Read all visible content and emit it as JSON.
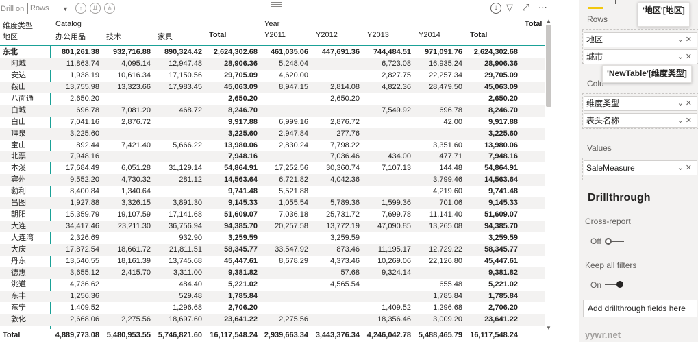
{
  "toolbar": {
    "drill_label": "Drill on",
    "drill_value": "Rows",
    "icons": [
      "arrow-up-icon",
      "double-arrow-down-icon",
      "expand-icon",
      "drill-down-icon",
      "filter-icon",
      "focus-mode-icon",
      "more-options-icon"
    ]
  },
  "matrix": {
    "row_headers": [
      "维度类型",
      "地区"
    ],
    "group_headers": {
      "catalog": "Catalog",
      "year": "Year",
      "grand_total": "Total"
    },
    "columns": [
      "办公用品",
      "技术",
      "家具",
      "Total",
      "Y2011",
      "Y2012",
      "Y2013",
      "Y2014",
      "Total"
    ],
    "rows": [
      {
        "name": "东北",
        "level": 0,
        "values": [
          "801,261.38",
          "932,716.88",
          "890,324.42",
          "2,624,302.68",
          "461,035.06",
          "447,691.36",
          "744,484.51",
          "971,091.76",
          "2,624,302.68"
        ]
      },
      {
        "name": "阿城",
        "level": 1,
        "values": [
          "11,863.74",
          "4,095.14",
          "12,947.48",
          "28,906.36",
          "5,248.04",
          "",
          "6,723.08",
          "16,935.24",
          "28,906.36"
        ]
      },
      {
        "name": "安达",
        "level": 1,
        "values": [
          "1,938.19",
          "10,616.34",
          "17,150.56",
          "29,705.09",
          "4,620.00",
          "",
          "2,827.75",
          "22,257.34",
          "29,705.09"
        ]
      },
      {
        "name": "鞍山",
        "level": 1,
        "values": [
          "13,755.98",
          "13,323.66",
          "17,983.45",
          "45,063.09",
          "8,947.15",
          "2,814.08",
          "4,822.36",
          "28,479.50",
          "45,063.09"
        ]
      },
      {
        "name": "八面通",
        "level": 1,
        "values": [
          "2,650.20",
          "",
          "",
          "2,650.20",
          "",
          "2,650.20",
          "",
          "",
          "2,650.20"
        ]
      },
      {
        "name": "白城",
        "level": 1,
        "values": [
          "696.78",
          "7,081.20",
          "468.72",
          "8,246.70",
          "",
          "",
          "7,549.92",
          "696.78",
          "8,246.70"
        ]
      },
      {
        "name": "白山",
        "level": 1,
        "values": [
          "7,041.16",
          "2,876.72",
          "",
          "9,917.88",
          "6,999.16",
          "2,876.72",
          "",
          "42.00",
          "9,917.88"
        ]
      },
      {
        "name": "拜泉",
        "level": 1,
        "values": [
          "3,225.60",
          "",
          "",
          "3,225.60",
          "2,947.84",
          "277.76",
          "",
          "",
          "3,225.60"
        ]
      },
      {
        "name": "宝山",
        "level": 1,
        "values": [
          "892.44",
          "7,421.40",
          "5,666.22",
          "13,980.06",
          "2,830.24",
          "7,798.22",
          "",
          "3,351.60",
          "13,980.06"
        ]
      },
      {
        "name": "北票",
        "level": 1,
        "values": [
          "7,948.16",
          "",
          "",
          "7,948.16",
          "",
          "7,036.46",
          "434.00",
          "477.71",
          "7,948.16"
        ]
      },
      {
        "name": "本溪",
        "level": 1,
        "values": [
          "17,684.49",
          "6,051.28",
          "31,129.14",
          "54,864.91",
          "17,252.56",
          "30,360.74",
          "7,107.13",
          "144.48",
          "54,864.91"
        ]
      },
      {
        "name": "宾州",
        "level": 1,
        "values": [
          "9,552.20",
          "4,730.32",
          "281.12",
          "14,563.64",
          "6,721.82",
          "4,042.36",
          "",
          "3,799.46",
          "14,563.64"
        ]
      },
      {
        "name": "勃利",
        "level": 1,
        "values": [
          "8,400.84",
          "1,340.64",
          "",
          "9,741.48",
          "5,521.88",
          "",
          "",
          "4,219.60",
          "9,741.48"
        ]
      },
      {
        "name": "昌图",
        "level": 1,
        "values": [
          "1,927.88",
          "3,326.15",
          "3,891.30",
          "9,145.33",
          "1,055.54",
          "5,789.36",
          "1,599.36",
          "701.06",
          "9,145.33"
        ]
      },
      {
        "name": "朝阳",
        "level": 1,
        "values": [
          "15,359.79",
          "19,107.59",
          "17,141.68",
          "51,609.07",
          "7,036.18",
          "25,731.72",
          "7,699.78",
          "11,141.40",
          "51,609.07"
        ]
      },
      {
        "name": "大连",
        "level": 1,
        "values": [
          "34,417.46",
          "23,211.30",
          "36,756.94",
          "94,385.70",
          "20,257.58",
          "13,772.19",
          "47,090.85",
          "13,265.08",
          "94,385.70"
        ]
      },
      {
        "name": "大连湾",
        "level": 1,
        "values": [
          "2,326.69",
          "",
          "932.90",
          "3,259.59",
          "",
          "3,259.59",
          "",
          "",
          "3,259.59"
        ]
      },
      {
        "name": "大庆",
        "level": 1,
        "values": [
          "17,872.54",
          "18,661.72",
          "21,811.51",
          "58,345.77",
          "33,547.92",
          "873.46",
          "11,195.17",
          "12,729.22",
          "58,345.77"
        ]
      },
      {
        "name": "丹东",
        "level": 1,
        "values": [
          "13,540.55",
          "18,161.39",
          "13,745.68",
          "45,447.61",
          "8,678.29",
          "4,373.46",
          "10,269.06",
          "22,126.80",
          "45,447.61"
        ]
      },
      {
        "name": "德惠",
        "level": 1,
        "values": [
          "3,655.12",
          "2,415.70",
          "3,311.00",
          "9,381.82",
          "",
          "57.68",
          "9,324.14",
          "",
          "9,381.82"
        ]
      },
      {
        "name": "洮道",
        "level": 1,
        "values": [
          "4,736.62",
          "",
          "484.40",
          "5,221.02",
          "",
          "4,565.54",
          "",
          "655.48",
          "5,221.02"
        ]
      },
      {
        "name": "东丰",
        "level": 1,
        "values": [
          "1,256.36",
          "",
          "529.48",
          "1,785.84",
          "",
          "",
          "",
          "1,785.84",
          "1,785.84"
        ]
      },
      {
        "name": "东宁",
        "level": 1,
        "values": [
          "1,409.52",
          "",
          "1,296.68",
          "2,706.20",
          "",
          "",
          "1,409.52",
          "1,296.68",
          "2,706.20"
        ]
      },
      {
        "name": "敦化",
        "level": 1,
        "values": [
          "2,668.06",
          "2,275.56",
          "18,697.60",
          "23,641.22",
          "2,275.56",
          "",
          "18,356.46",
          "3,009.20",
          "23,641.22"
        ]
      }
    ],
    "total": {
      "name": "Total",
      "values": [
        "4,889,773.08",
        "5,480,953.55",
        "5,746,821.60",
        "16,117,548.24",
        "2,939,663.34",
        "3,443,376.34",
        "4,246,042.78",
        "5,488,465.79",
        "16,117,548.24"
      ]
    }
  },
  "pane": {
    "rows_label": "Rows",
    "rows_fields": [
      "地区",
      "城市"
    ],
    "columns_label": "Colu",
    "columns_fields": [
      "维度类型",
      "表头名称"
    ],
    "values_label": "Values",
    "values_fields": [
      "SaleMeasure"
    ],
    "tooltip_top": "'地区'[地区]",
    "tooltip_mid": "'NewTable'[维度类型]",
    "drillthrough_title": "Drillthrough",
    "cross_report_label": "Cross-report",
    "cross_report_state": "Off",
    "keep_filters_label": "Keep all filters",
    "keep_filters_state": "On",
    "add_drillthrough": "Add drillthrough fields here",
    "watermark": "yywr.net"
  },
  "colors": {
    "accent_teal": "#1aa197",
    "highlight_yellow": "#f2c80f",
    "pane_bg": "#f3f2f1"
  }
}
